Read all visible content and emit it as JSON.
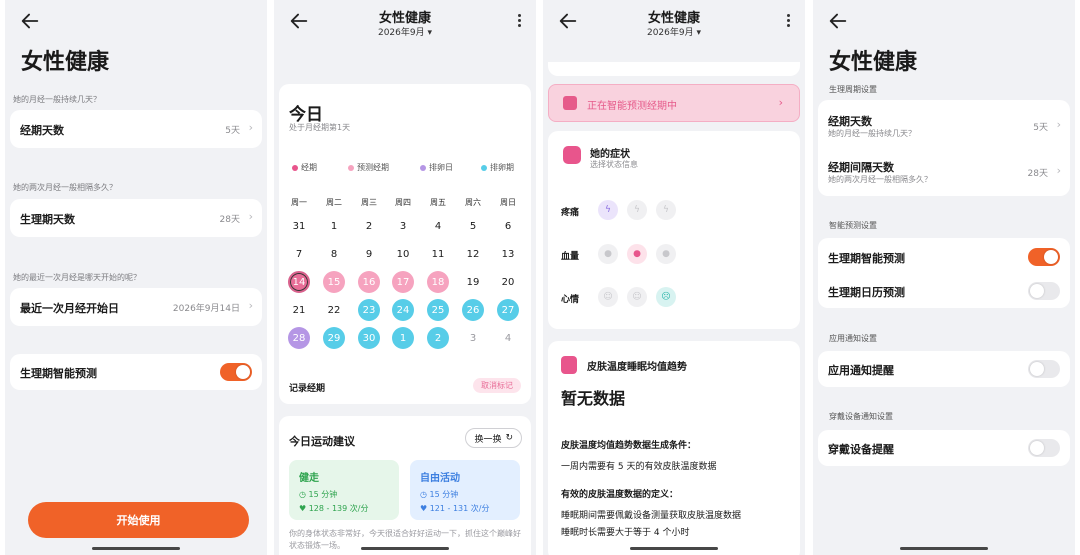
{
  "screen1": {
    "title": "女性健康",
    "q1": "她的月经一般持续几天？",
    "row1_label": "经期天数",
    "row1_value": "5天",
    "q2": "她的两次月经一般相隔多久？",
    "row2_label": "生理期天数",
    "row2_value": "28天",
    "q3": "她的最近一次月经是哪天开始的呢？",
    "row3_label": "最近一次月经开始日",
    "row3_value": "2026年9月14日",
    "toggle_label": "生理期智能预测",
    "toggle_on": true,
    "start_button": "开始使用"
  },
  "screen2": {
    "title": "女性健康",
    "month": "2026年9月",
    "today": "今日",
    "today_sub": "处于月经期第1天",
    "legend": [
      "经期",
      "预测经期",
      "排卵日",
      "排卵期"
    ],
    "legend_colors": [
      "#e8558c",
      "#f6a3bf",
      "#b596e5",
      "#57cde8"
    ],
    "weekdays": [
      "周一",
      "周二",
      "周三",
      "周四",
      "周五",
      "周六",
      "周日"
    ],
    "weeks": [
      [
        "31",
        "1",
        "2",
        "3",
        "4",
        "5",
        "6"
      ],
      [
        "7",
        "8",
        "9",
        "10",
        "11",
        "12",
        "13"
      ],
      [
        "14",
        "15",
        "16",
        "17",
        "18",
        "19",
        "20"
      ],
      [
        "21",
        "22",
        "23",
        "24",
        "25",
        "26",
        "27"
      ],
      [
        "28",
        "29",
        "30",
        "1",
        "2",
        "3",
        "4"
      ]
    ],
    "record_label": "记录经期",
    "unmark_label": "取消标记",
    "exercise_title": "今日运动建议",
    "swap_label": "换一换",
    "ex1_name": "健走",
    "ex1_time": "15 分钟",
    "ex1_hr": "128 - 139 次/分",
    "ex2_name": "自由活动",
    "ex2_time": "15 分钟",
    "ex2_hr": "121 - 131 次/分",
    "ex_note": "你的身体状态非常好，今天很适合好好运动一下，抓住这个巅峰好状态锻炼一场。"
  },
  "screen3": {
    "title": "女性健康",
    "month": "2026年9月",
    "predict_banner": "正在智能预测经期中",
    "symptoms_title": "她的症状",
    "symptoms_sub": "选择状态信息",
    "sym1": "疼痛",
    "sym2": "血量",
    "sym3": "心情",
    "skin_title": "皮肤温度睡眠均值趋势",
    "no_data": "暂无数据",
    "cond_title": "皮肤温度均值趋势数据生成条件：",
    "cond_1": "一周内需要有 5 天的有效皮肤温度数据",
    "def_title": "有效的皮肤温度数据的定义：",
    "def_1": "睡眠期间需要佩戴设备测量获取皮肤温度数据",
    "def_2": "睡眠时长需要大于等于 4 个小时"
  },
  "screen4": {
    "title": "女性健康",
    "sec1": "生理周期设置",
    "r1_label": "经期天数",
    "r1_sub": "她的月经一般持续几天？",
    "r1_value": "5天",
    "r2_label": "经期间隔天数",
    "r2_sub": "她的两次月经一般相隔多久？",
    "r2_value": "28天",
    "sec2": "智能预测设置",
    "r3_label": "生理期智能预测",
    "r3_on": true,
    "r4_label": "生理期日历预测",
    "r4_on": false,
    "sec3": "应用通知设置",
    "r5_label": "应用通知提醒",
    "r5_on": false,
    "sec4": "穿戴设备通知设置",
    "r6_label": "穿戴设备提醒",
    "r6_on": false
  },
  "colors": {
    "accent_orange": "#f06228",
    "period_pink": "#e8558c",
    "predicted_pink": "#f6a3bf",
    "ovulation_purple": "#b596e5",
    "fertile_cyan": "#57cde8"
  }
}
